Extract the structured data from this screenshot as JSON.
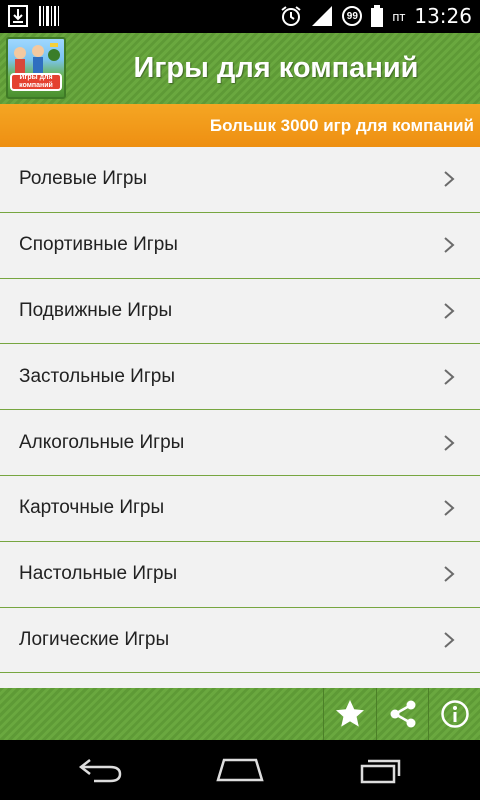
{
  "status_bar": {
    "time": "13:26",
    "day": "пт",
    "badge": "99",
    "icons": [
      "download-icon",
      "barcode-icon",
      "alarm-icon",
      "signal-icon",
      "battery-icon"
    ]
  },
  "header": {
    "title": "Игры для компаний",
    "logo_text_line1": "Игры для",
    "logo_text_line2": "компаний"
  },
  "banner": {
    "text": "Большк 3000 игр для компаний"
  },
  "categories": [
    {
      "label": "Ролевые Игры"
    },
    {
      "label": "Спортивные Игры"
    },
    {
      "label": "Подвижные Игры"
    },
    {
      "label": "Застольные Игры"
    },
    {
      "label": "Алкогольные Игры"
    },
    {
      "label": "Карточные Игры"
    },
    {
      "label": "Настольные Игры"
    },
    {
      "label": "Логические Игры"
    }
  ],
  "bottom_bar": {
    "buttons": [
      "star-icon",
      "share-icon",
      "info-icon"
    ]
  },
  "nav_bar": {
    "buttons": [
      "back-icon",
      "home-icon",
      "recents-icon"
    ]
  },
  "colors": {
    "header_green": "#6aa83f",
    "banner_orange": "#f29a1a",
    "divider_green": "#77a640",
    "list_bg": "#f2f2f2"
  }
}
